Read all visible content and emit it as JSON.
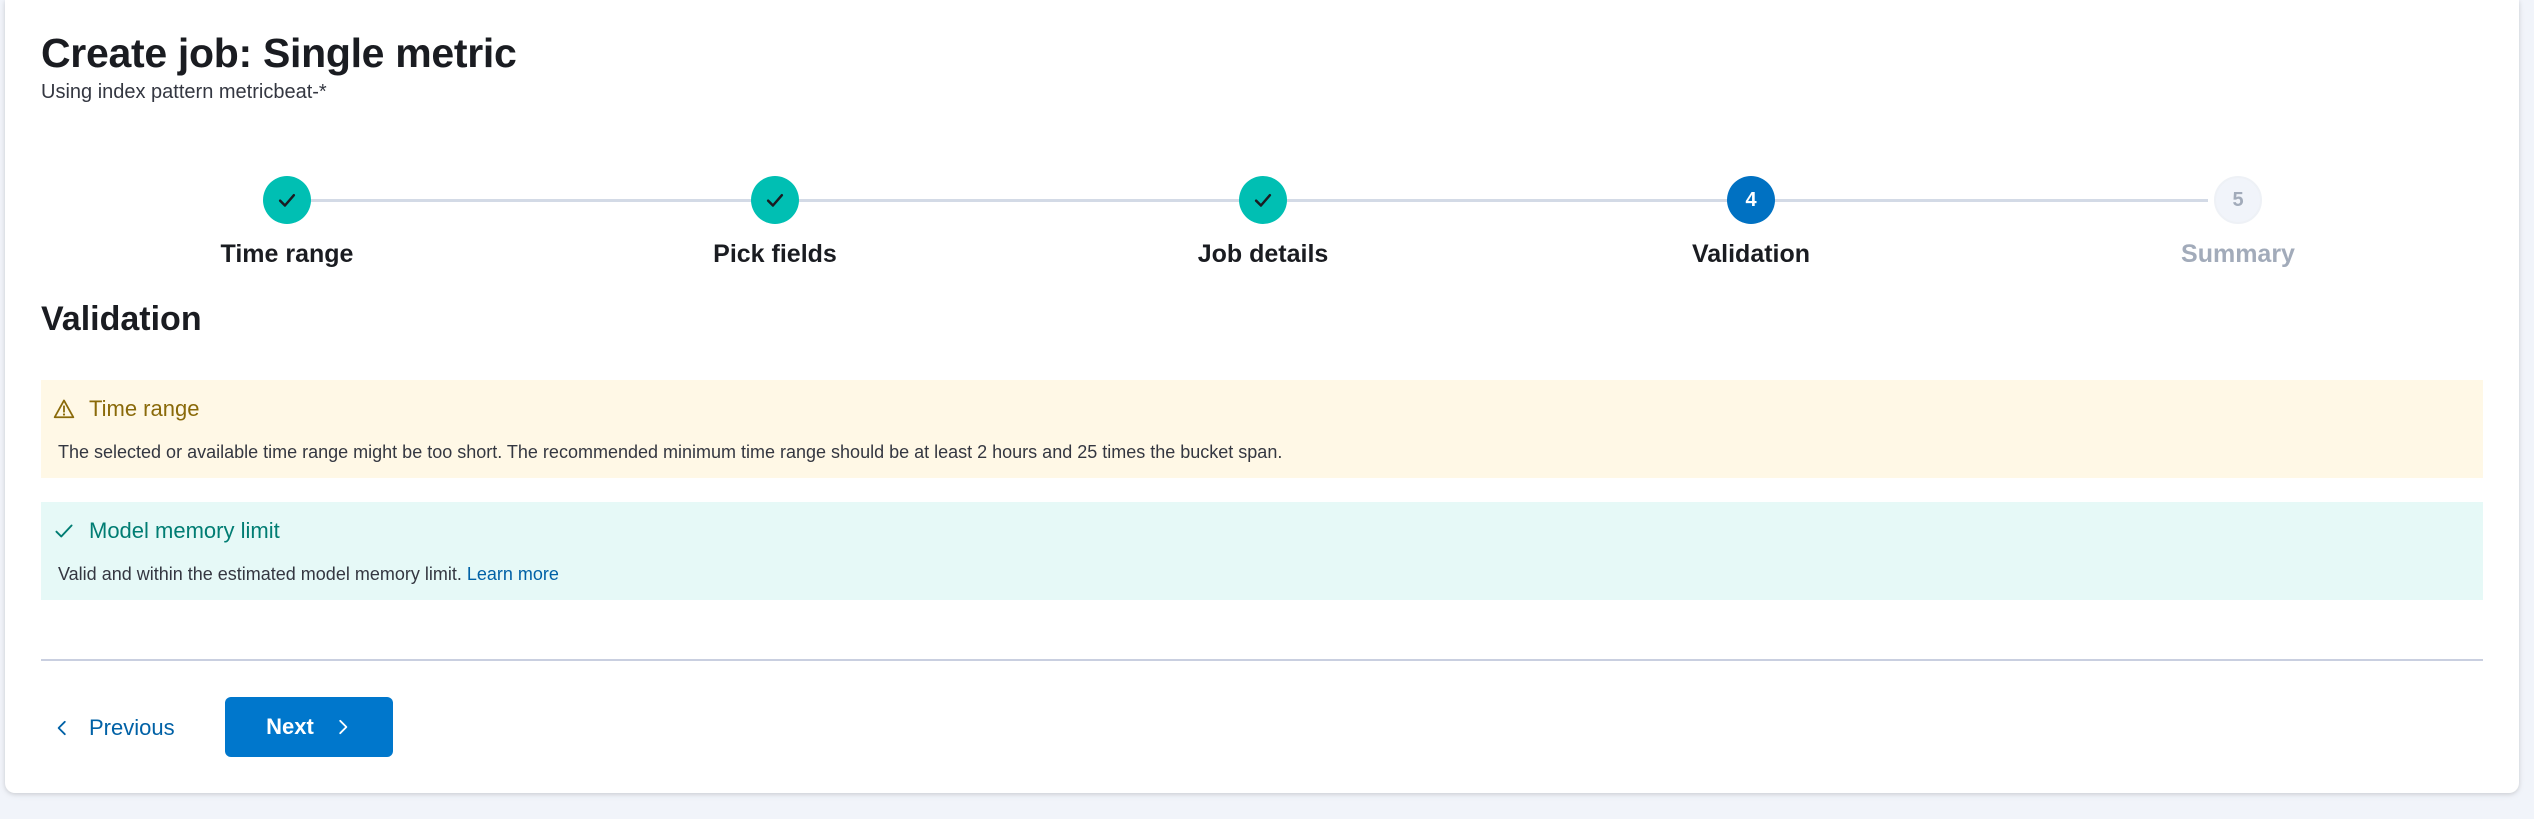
{
  "header": {
    "title": "Create job: Single metric",
    "subtitle": "Using index pattern metricbeat-*"
  },
  "steps": [
    {
      "label": "Time range",
      "status": "complete",
      "number": "1"
    },
    {
      "label": "Pick fields",
      "status": "complete",
      "number": "2"
    },
    {
      "label": "Job details",
      "status": "complete",
      "number": "3"
    },
    {
      "label": "Validation",
      "status": "current",
      "number": "4"
    },
    {
      "label": "Summary",
      "status": "incomplete",
      "number": "5"
    }
  ],
  "section_title": "Validation",
  "callouts": [
    {
      "type": "warning",
      "icon": "alert-triangle-icon",
      "title": "Time range",
      "body": "The selected or available time range might be too short. The recommended minimum time range should be at least 2 hours and 25 times the bucket span.",
      "color": "#fff8e6"
    },
    {
      "type": "success",
      "icon": "check-icon",
      "title": "Model memory limit",
      "body": "Valid and within the estimated model memory limit.",
      "link_text": "Learn more",
      "color": "#e6f9f7"
    }
  ],
  "footer": {
    "previous_label": "Previous",
    "next_label": "Next"
  },
  "colors": {
    "primary": "#0077cc",
    "success": "#00bfb3",
    "warning_text": "#8a6a0a",
    "success_text": "#017d73"
  }
}
